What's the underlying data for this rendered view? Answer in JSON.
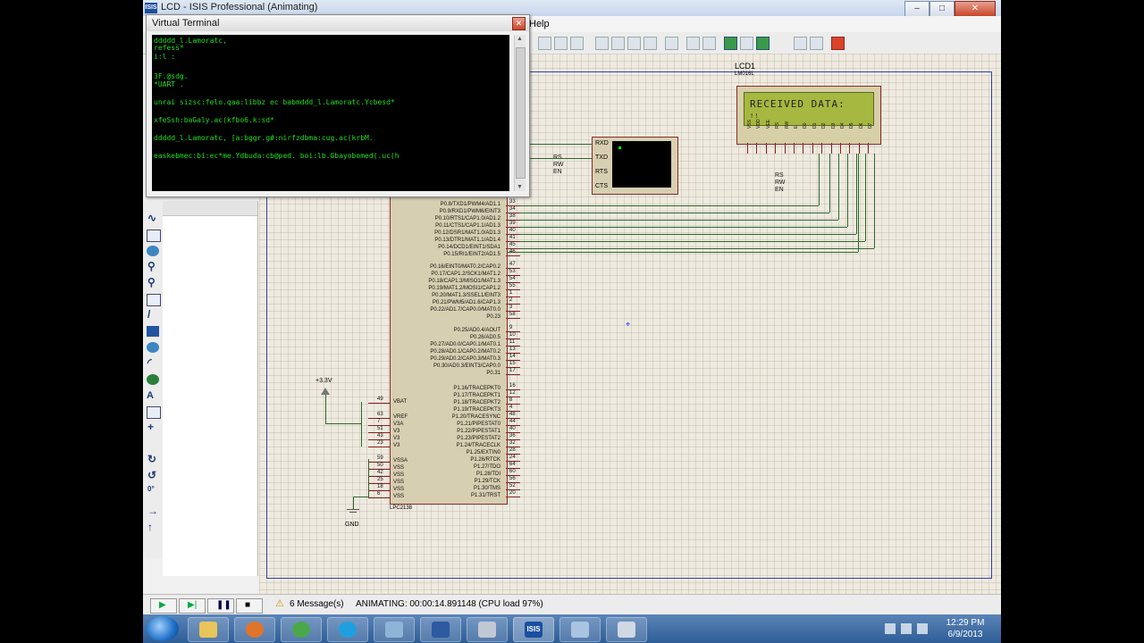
{
  "app": {
    "title": "LCD - ISIS Professional (Animating)",
    "icon": "ISIS",
    "help_menu": "Help"
  },
  "window_controls": {
    "minimize": "–",
    "maximize": "□",
    "close": "✕"
  },
  "virtual_terminal": {
    "title": "Virtual Terminal",
    "close": "✕",
    "lines": [
      "ddddd_l.Lamoratc,",
      " refess*",
      "i:l :",
      "3F.@sdg.",
      "*UART .",
      "unrai sizsc:felo.qaa:libbz ec babmddd_l.Lamoratc.Ycbesd*",
      "xfeSsh:baGaly.ac(kfbo6.k:sd*",
      "ddddd_l.Lamoratc, [a:bggr.g#:nirfzdbma:cug.ac(krbM.",
      "easkebmec:bi:ec*me.Ydbuda:cb@ped. boi:lb.Gbayobomed(.uc(h"
    ]
  },
  "schematic": {
    "lcd": {
      "ref": "LCD1",
      "part": "LM016L",
      "display_line1": "RECEIVED DATA:",
      "display_line2": "!!",
      "pin_labels": [
        "VSS",
        "VDD",
        "VEE",
        "RS",
        "RW",
        "E",
        "D0",
        "D1",
        "D2",
        "D3",
        "D4",
        "D5",
        "D6",
        "D7"
      ],
      "ctrl_labels": [
        "RS",
        "RW",
        "EN"
      ]
    },
    "terminal_part": {
      "pins_left": [
        "RXD",
        "TXD",
        "RTS",
        "CTS"
      ],
      "nets": [
        "RS",
        "RW",
        "EN"
      ]
    },
    "chip": {
      "part": "LPC2138",
      "right_pins": [
        "P0.8/TXD1/PWM4/AD1.1",
        "P0.9/RXD1/PWM6/EINT3",
        "P0.10/RTS1/CAP1.0/AD1.2",
        "P0.11/CTS1/CAP1.1/AD1.3",
        "P0.12/DSR1/MAT1.0/AD1.3",
        "P0.13/DTR1/MAT1.1/AD1.4",
        "P0.14/DCD1/EINT1/SDA1",
        "P0.15/RI1/EINT2/AD1.5",
        "P0.16/EINT0/MAT0.2/CAP0.2",
        "P0.17/CAP1.2/SCK1/MAT1.2",
        "P0.18/CAP1.3/MISO1/MAT1.3",
        "P0.19/MAT1.2/MOSI1/CAP1.2",
        "P0.20/MAT1.3/SSEL1/EINT3",
        "P0.21/PWM5/AD1.6/CAP1.3",
        "P0.22/AD1.7/CAP0.0/MAT0.0",
        "P0.23",
        "P0.25/AD0.4/AOUT",
        "P0.26/AD0.5",
        "P0.27/AD0.0/CAP0.1/MAT0.1",
        "P0.28/AD0.1/CAP0.2/MAT0.2",
        "P0.29/AD0.2/CAP0.3/MAT0.3",
        "P0.30/AD0.3/EINT3/CAP0.0",
        "P0.31",
        "P1.16/TRACEPKT0",
        "P1.17/TRACEPKT1",
        "P1.18/TRACEPKT2",
        "P1.19/TRACEPKT3",
        "P1.20/TRACESYNC",
        "P1.21/PIPESTAT0",
        "P1.22/PIPESTAT1",
        "P1.23/PIPESTAT2",
        "P1.24/TRACECLK",
        "P1.25/EXTIN0",
        "P1.26/RTCK",
        "P1.27/TDO",
        "P1.28/TDI",
        "P1.29/TCK",
        "P1.30/TMS",
        "P1.31/TRST"
      ],
      "right_pin_numbers": [
        "33",
        "34",
        "38",
        "39",
        "40",
        "41",
        "45",
        "46",
        "47",
        "53",
        "54",
        "55",
        "1",
        "2",
        "3",
        "58",
        "9",
        "10",
        "11",
        "13",
        "14",
        "15",
        "17",
        "16",
        "12",
        "8",
        "4",
        "48",
        "44",
        "40",
        "36",
        "32",
        "28",
        "24",
        "64",
        "60",
        "56",
        "52",
        "20"
      ],
      "left_pins": [
        "VBAT",
        "VREF",
        "V3A",
        "V3",
        "V3",
        "V3",
        "VSSA",
        "VSS",
        "VSS",
        "VSS",
        "VSS",
        "VSS"
      ],
      "left_pin_numbers": [
        "49",
        "63",
        "7",
        "51",
        "43",
        "23",
        "59",
        "50",
        "42",
        "25",
        "18",
        "6"
      ]
    },
    "power_label": "+3.3V",
    "ground_label": "GND"
  },
  "status": {
    "messages": "6 Message(s)",
    "animating": "ANIMATING: 00:00:14.891148 (CPU load 97%)"
  },
  "taskbar": {
    "time": "12:29 PM",
    "date": "6/9/2013",
    "isis_label": "ISIS"
  }
}
